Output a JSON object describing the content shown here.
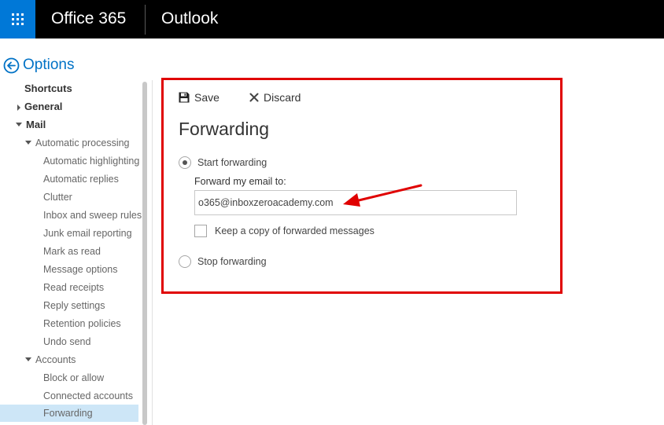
{
  "topbar": {
    "brand": "Office 365",
    "app_name": "Outlook",
    "waffle_icon": "app-launcher-icon"
  },
  "options": {
    "title": "Options",
    "back_icon": "back-arrow-circle-icon"
  },
  "sidebar": {
    "items": [
      {
        "label": "Shortcuts",
        "level": 0
      },
      {
        "label": "General",
        "level": 0,
        "expander": "collapsed"
      },
      {
        "label": "Mail",
        "level": 0,
        "expander": "expanded"
      },
      {
        "label": "Automatic processing",
        "level": 1,
        "expander": "expanded"
      },
      {
        "label": "Automatic highlighting",
        "level": 2
      },
      {
        "label": "Automatic replies",
        "level": 2
      },
      {
        "label": "Clutter",
        "level": 2
      },
      {
        "label": "Inbox and sweep rules",
        "level": 2
      },
      {
        "label": "Junk email reporting",
        "level": 2
      },
      {
        "label": "Mark as read",
        "level": 2
      },
      {
        "label": "Message options",
        "level": 2
      },
      {
        "label": "Read receipts",
        "level": 2
      },
      {
        "label": "Reply settings",
        "level": 2
      },
      {
        "label": "Retention policies",
        "level": 2
      },
      {
        "label": "Undo send",
        "level": 2
      },
      {
        "label": "Accounts",
        "level": 1,
        "expander": "expanded"
      },
      {
        "label": "Block or allow",
        "level": 2
      },
      {
        "label": "Connected accounts",
        "level": 2
      },
      {
        "label": "Forwarding",
        "level": 2,
        "selected": true
      }
    ]
  },
  "panel": {
    "save_label": "Save",
    "discard_label": "Discard",
    "title": "Forwarding",
    "start_forwarding_label": "Start forwarding",
    "start_forwarding_selected": true,
    "forward_to_label": "Forward my email to:",
    "forward_to_value": "o365@inboxzeroacademy.com",
    "keep_copy_label": "Keep a copy of forwarded messages",
    "keep_copy_checked": false,
    "stop_forwarding_label": "Stop forwarding",
    "stop_forwarding_selected": false
  },
  "colors": {
    "accent": "#0078d7",
    "link": "#0072c6",
    "highlight_border": "#e00000",
    "selected_bg": "#cde6f7"
  }
}
